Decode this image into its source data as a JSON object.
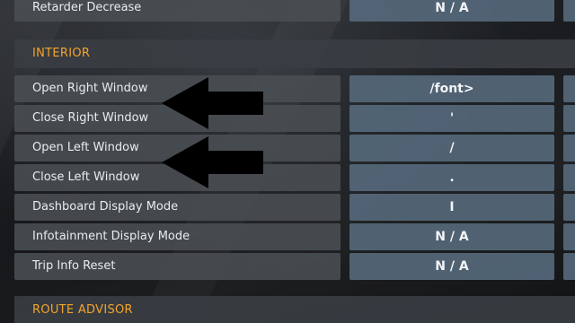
{
  "top_row": {
    "label": "Retarder Decrease",
    "value": "N / A"
  },
  "sections": {
    "interior": {
      "title": "INTERIOR",
      "rows": [
        {
          "label": "Open Right Window",
          "value": "/font>"
        },
        {
          "label": "Close Right Window",
          "value": "'"
        },
        {
          "label": "Open Left Window",
          "value": "/"
        },
        {
          "label": "Close Left Window",
          "value": "."
        },
        {
          "label": "Dashboard Display Mode",
          "value": "I"
        },
        {
          "label": "Infotainment Display Mode",
          "value": "N / A"
        },
        {
          "label": "Trip Info Reset",
          "value": "N / A"
        }
      ]
    },
    "route_advisor": {
      "title": "ROUTE ADVISOR"
    }
  },
  "annotations": {
    "arrow_color": "#000000",
    "arrow_icon": "left-arrow-icon"
  },
  "colors": {
    "accent": "#f3a42a",
    "label_bg": "#4a4e53",
    "value_bg": "#55687a"
  }
}
